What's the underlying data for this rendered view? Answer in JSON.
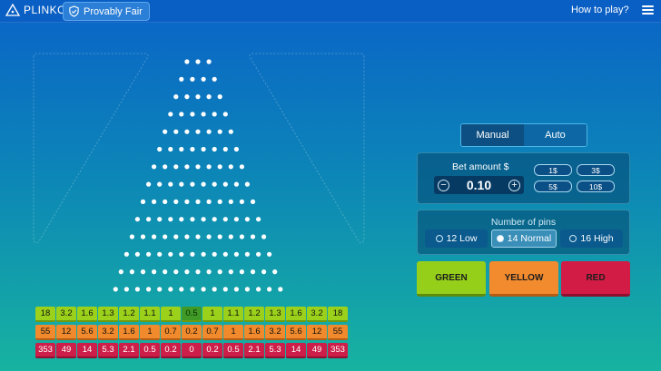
{
  "header": {
    "logo_text": "PLINKO",
    "provably_fair_label": "Provably Fair",
    "how_to_play_label": "How to play?"
  },
  "board": {
    "pin_rows": 14,
    "multipliers": {
      "green": [
        "18",
        "3.2",
        "1.6",
        "1.3",
        "1.2",
        "1.1",
        "1",
        "0.5",
        "1",
        "1.1",
        "1.2",
        "1.3",
        "1.6",
        "3.2",
        "18"
      ],
      "orange": [
        "55",
        "12",
        "5.6",
        "3.2",
        "1.6",
        "1",
        "0.7",
        "0.2",
        "0.7",
        "1",
        "1.6",
        "3.2",
        "5.6",
        "12",
        "55"
      ],
      "red": [
        "353",
        "49",
        "14",
        "5.3",
        "2.1",
        "0.5",
        "0.2",
        "0",
        "0.2",
        "0.5",
        "2.1",
        "5.3",
        "14",
        "49",
        "353"
      ]
    }
  },
  "mode_tabs": [
    {
      "label": "Manual",
      "active": true
    },
    {
      "label": "Auto",
      "active": false
    }
  ],
  "bet": {
    "label": "Bet amount $",
    "value": "0.10",
    "quick_amounts": [
      "1$",
      "3$",
      "5$",
      "10$"
    ]
  },
  "pins": {
    "label": "Number of pins",
    "options": [
      {
        "label": "12 Low",
        "selected": false
      },
      {
        "label": "14 Normal",
        "selected": true
      },
      {
        "label": "16 High",
        "selected": false
      }
    ]
  },
  "color_buttons": [
    "GREEN",
    "YELLOW",
    "RED"
  ],
  "colors": {
    "green": "#95cf1a",
    "yellow": "#f28a2e",
    "red": "#d21c45",
    "header": "#0a5fc4"
  }
}
